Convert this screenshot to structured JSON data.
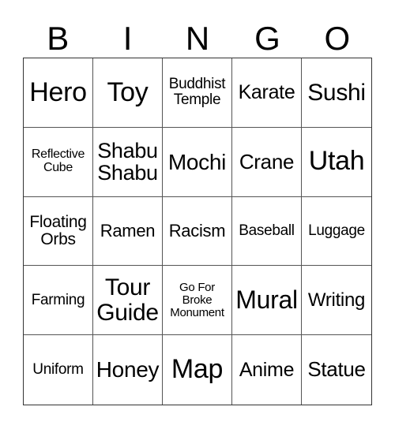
{
  "header": {
    "letters": [
      "B",
      "I",
      "N",
      "G",
      "O"
    ]
  },
  "cells": [
    "Hero",
    "Toy",
    "Buddhist\nTemple",
    "Karate",
    "Sushi",
    "Reflective\nCube",
    "Shabu\nShabu",
    "Mochi",
    "Crane",
    "Utah",
    "Floating\nOrbs",
    "Ramen",
    "Racism",
    "Baseball",
    "Luggage",
    "Farming",
    "Tour\nGuide",
    "Go For\nBroke\nMonument",
    "Mural",
    "Writing",
    "Uniform",
    "Honey",
    "Map",
    "Anime",
    "Statue"
  ]
}
